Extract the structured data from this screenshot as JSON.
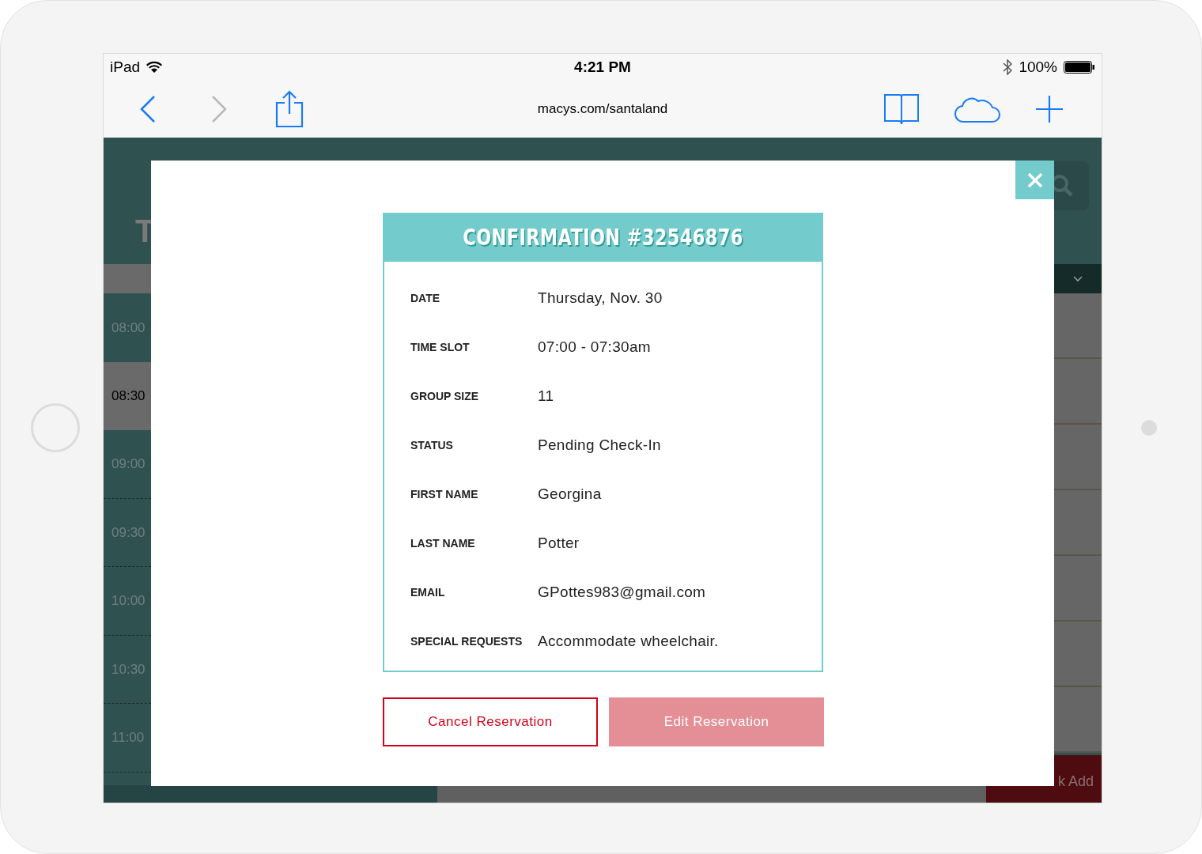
{
  "status_bar": {
    "device": "iPad",
    "time": "4:21 PM",
    "battery": "100%"
  },
  "browser": {
    "url": "macys.com/santaland"
  },
  "background": {
    "heading": "T",
    "times": [
      {
        "label": "08:00",
        "selected": false
      },
      {
        "label": "08:30",
        "selected": true
      },
      {
        "label": "09:00",
        "selected": false
      },
      {
        "label": "09:30",
        "selected": false
      },
      {
        "label": "10:00",
        "selected": false
      },
      {
        "label": "10:30",
        "selected": false
      },
      {
        "label": "11:00",
        "selected": false
      }
    ],
    "quick_add": "k Add"
  },
  "modal": {
    "title": "CONFIRMATION #32546876",
    "fields": [
      {
        "label": "DATE",
        "value": "Thursday, Nov. 30"
      },
      {
        "label": "TIME SLOT",
        "value": "07:00 - 07:30am"
      },
      {
        "label": "GROUP SIZE",
        "value": "11"
      },
      {
        "label": "STATUS",
        "value": "Pending Check-In"
      },
      {
        "label": "FIRST NAME",
        "value": "Georgina"
      },
      {
        "label": "LAST NAME",
        "value": "Potter"
      },
      {
        "label": "EMAIL",
        "value": "GPottes983@gmail.com"
      },
      {
        "label": "SPECIAL REQUESTS",
        "value": "Accommodate wheelchair."
      }
    ],
    "buttons": [
      {
        "label": "Cancel Reservation",
        "kind": "outline"
      },
      {
        "label": "Edit Reservation",
        "kind": "filled"
      }
    ]
  }
}
